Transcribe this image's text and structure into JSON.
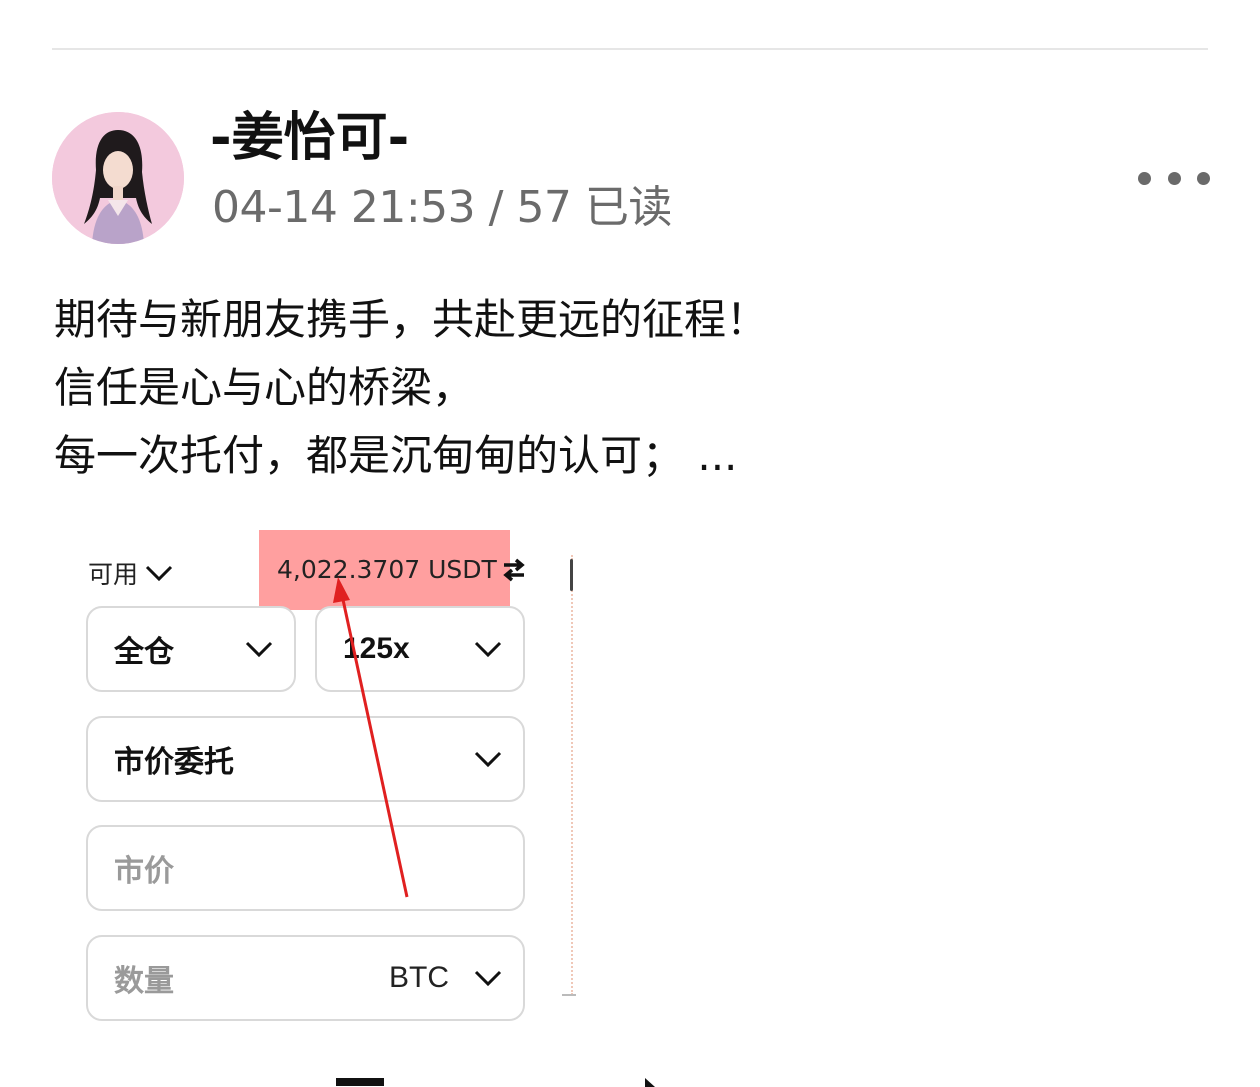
{
  "post": {
    "author": "-姜怡可-",
    "meta": "04-14 21:53 / 57 已读",
    "text_lines": [
      "期待与新朋友携手，共赴更远的征程！",
      "信任是心与心的桥梁，",
      "每一次托付，都是沉甸甸的认可；   ..."
    ]
  },
  "screenshot": {
    "available_label": "可用",
    "balance": "4,022.3707 USDT",
    "margin_mode": "全仓",
    "leverage": "125x",
    "order_type": "市价委托",
    "price_placeholder": "市价",
    "quantity_placeholder": "数量",
    "quantity_unit": "BTC",
    "highlight_color": "#ff5050",
    "arrow_color": "#e02020"
  },
  "icons": {
    "more": "more-horizontal-icon",
    "chevron": "chevron-down-icon",
    "swap": "swap-icon"
  }
}
